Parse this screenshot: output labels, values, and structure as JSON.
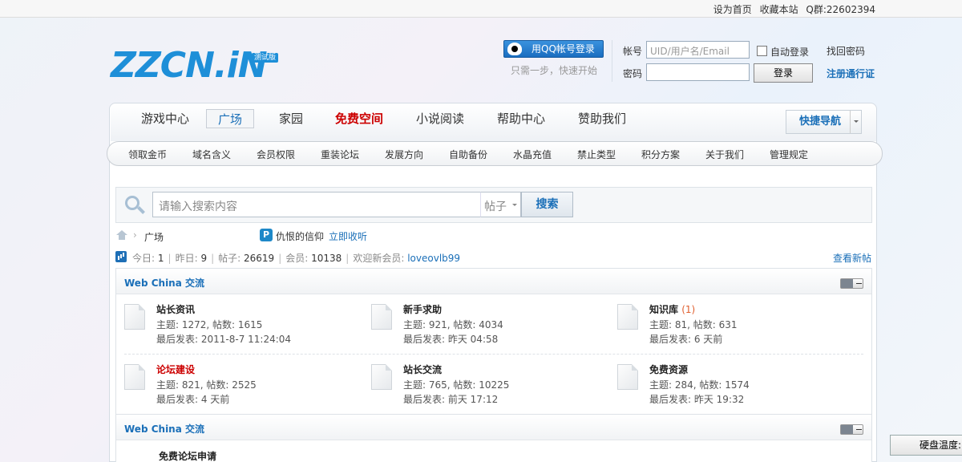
{
  "topbar": {
    "set_home": "设为首页",
    "bookmark": "收藏本站",
    "qq_group": "Q群:22602394"
  },
  "logo": {
    "text": "ZZCN.iN",
    "badge": "测试版"
  },
  "login": {
    "qq_button": "用QQ帐号登录",
    "qq_hint": "只需一步，快速开始",
    "account_label": "帐号",
    "account_placeholder": "UID/用户名/Email",
    "auto_login": "自动登录",
    "find_password": "找回密码",
    "password_label": "密码",
    "login_button": "登录",
    "register": "注册通行证"
  },
  "main_nav": {
    "items": [
      "游戏中心",
      "广场",
      "家园",
      "免费空间",
      "小说阅读",
      "帮助中心",
      "赞助我们"
    ],
    "active": "广场",
    "quick_nav": "快捷导航"
  },
  "sub_nav": [
    "领取金币",
    "域名含义",
    "会员权限",
    "重装论坛",
    "发展方向",
    "自助备份",
    "水晶充值",
    "禁止类型",
    "积分方案",
    "关于我们",
    "管理规定"
  ],
  "search": {
    "placeholder": "请输入搜索内容",
    "type": "帖子",
    "button": "搜索"
  },
  "breadcrumb": {
    "current": "广场",
    "feed_text": "仇恨的信仰",
    "feed_link": "立即收听"
  },
  "stats": {
    "today_label": "今日:",
    "today": "1",
    "yesterday_label": "昨日:",
    "yesterday": "9",
    "posts_label": "帖子:",
    "posts": "26619",
    "members_label": "会员:",
    "members": "10138",
    "welcome_label": "欢迎新会员:",
    "newest_member": "loveovlb99",
    "view_new": "查看新帖"
  },
  "groups": [
    {
      "title": "Web China 交流",
      "forums": [
        {
          "name": "站长资讯",
          "count": "",
          "topics": "主题: 1272, 帖数: 1615",
          "last": "最后发表: 2011-8-7 11:24:04"
        },
        {
          "name": "新手求助",
          "count": "",
          "topics": "主题: 921, 帖数: 4034",
          "last": "最后发表: 昨天 04:58"
        },
        {
          "name": "知识库",
          "count": "(1)",
          "topics": "主题: 81, 帖数: 631",
          "last": "最后发表: 6 天前"
        },
        {
          "name": "论坛建设",
          "count": "",
          "topics": "主题: 821, 帖数: 2525",
          "last": "最后发表: 4 天前"
        },
        {
          "name": "站长交流",
          "count": "",
          "topics": "主题: 765, 帖数: 10225",
          "last": "最后发表: 前天 17:12"
        },
        {
          "name": "免费资源",
          "count": "",
          "topics": "主题: 284, 帖数: 1574",
          "last": "最后发表: 昨天 19:32"
        }
      ]
    },
    {
      "title": "Web China 交流",
      "forums": [
        {
          "name": "免费论坛申请"
        }
      ]
    }
  ],
  "disk_temp": "硬盘温度:"
}
